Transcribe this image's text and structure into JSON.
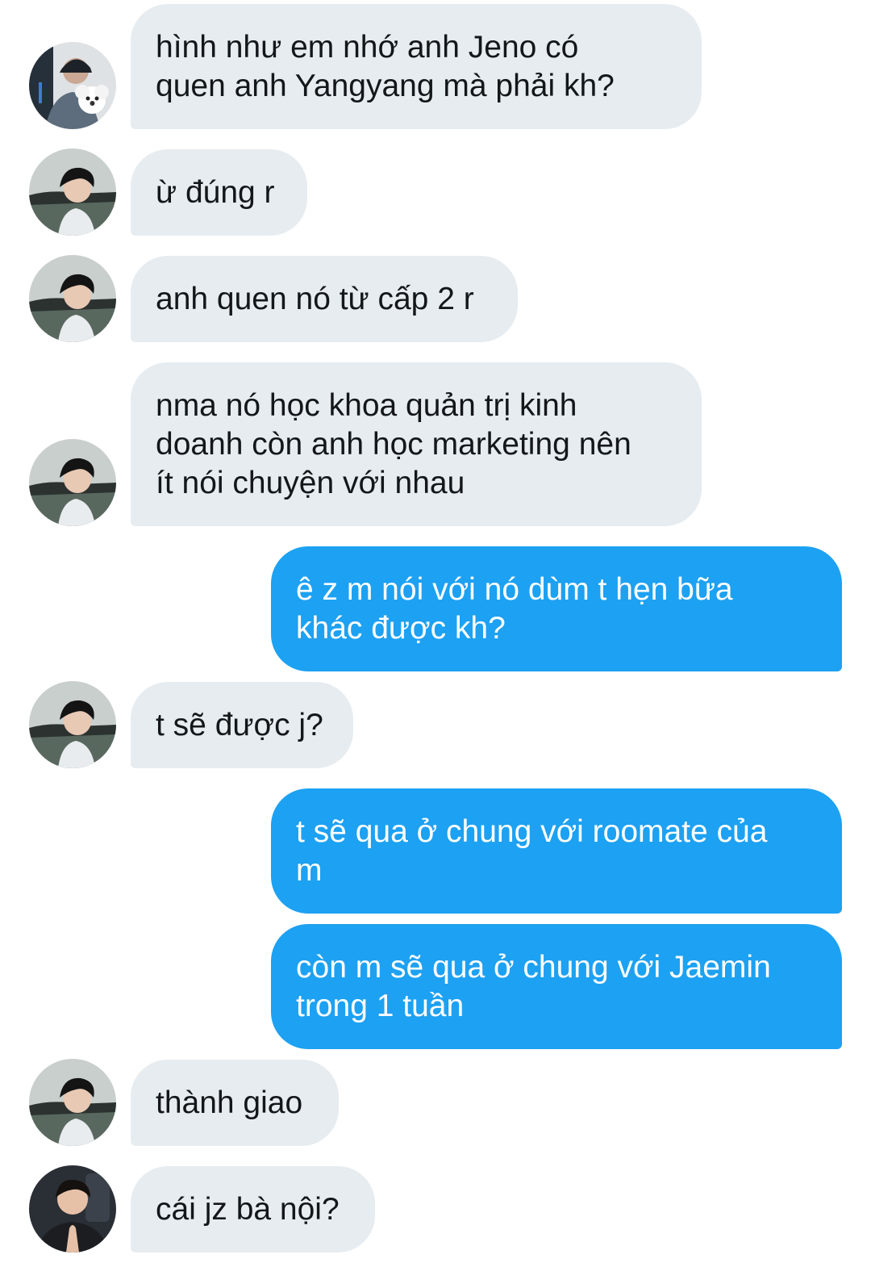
{
  "conversation": {
    "messages": [
      {
        "sender": "other",
        "avatar": "avatar-dog-cap-icon",
        "text": "hình như em nhớ anh Jeno có\nquen anh Yangyang mà phải kh?"
      },
      {
        "sender": "other",
        "avatar": "avatar-boy-icon",
        "text": "ừ đúng r"
      },
      {
        "sender": "other",
        "avatar": "avatar-boy-icon",
        "text": "anh quen nó từ cấp 2 r"
      },
      {
        "sender": "other",
        "avatar": "avatar-boy-icon",
        "text": "nma nó học khoa quản trị kinh\ndoanh còn anh học marketing nên\nít nói chuyện với nhau"
      },
      {
        "sender": "me",
        "text": "ê z m nói với nó dùm t hẹn bữa\nkhác được kh?"
      },
      {
        "sender": "other",
        "avatar": "avatar-boy-icon",
        "text": "t sẽ được j?"
      },
      {
        "sender": "me",
        "text": "t sẽ qua ở chung với roomate của\nm"
      },
      {
        "sender": "me",
        "text": "còn m sẽ qua ở chung với Jaemin\ntrong 1 tuần"
      },
      {
        "sender": "other",
        "avatar": "avatar-boy-icon",
        "text": "thành giao"
      },
      {
        "sender": "other",
        "avatar": "avatar-praying-boy-icon",
        "text": "cái jz bà nội?"
      }
    ]
  },
  "colors": {
    "incoming_bubble": "#e6ecf0",
    "outgoing_bubble": "#1da1f2",
    "incoming_text": "#14171a",
    "outgoing_text": "#ffffff"
  }
}
